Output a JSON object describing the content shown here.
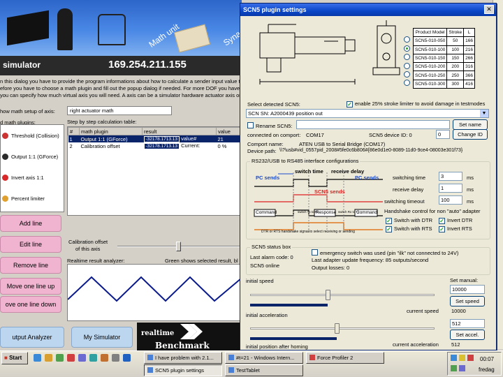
{
  "simulator": {
    "banner_title": "simulator",
    "banner_ip": "169.254.211.155",
    "banner_math": "Math unit",
    "banner_synap": "Synap",
    "info_lines": [
      "n this dialog you have to provide the program informations about how to calculate a sender input value t",
      "efore you have to choose a math plugin and fill out the popup dialog if needed. For more DOF you have",
      "you can specify how much virtual axis you will need. A axis can be a simulator hardware actuator axis or"
    ],
    "show_math_label": "how math setup of axis:",
    "axis_select": "right actuator math",
    "step_table_label": "Step by step calculation table:",
    "math_plugins_label": "d math plugins:",
    "plugins": [
      "Threshold (Collision)",
      "Output 1:1 (GForce)",
      "Invert axis 1:1",
      "Percent limiter"
    ],
    "table_headers": [
      "#",
      "math plugin",
      "result",
      "value"
    ],
    "table_rows": [
      {
        "num": "1",
        "plugin": "Output 1:1 (GForce)",
        "result": "-32178.1713.13",
        "vlabel": "value#",
        "value": "21"
      },
      {
        "num": "2",
        "plugin": "Calibration offset",
        "result": "-32178.1713.13",
        "vlabel": "Current:",
        "value": "0 %"
      }
    ],
    "buttons": [
      "Add line",
      "Edit line",
      "Remove line",
      "Move one line up",
      "ove one line down"
    ],
    "calib_label_1": "Calibration offset",
    "calib_label_2": "of this axis",
    "analyzer_label": "Realtime result analyzer:",
    "analyzer_hint": "Green shows selected result, bl",
    "output_analyzer": "utput Analyzer",
    "my_simulator": "My Simulator",
    "benchmark_1": "realtime",
    "benchmark_2": "Benchmark"
  },
  "dialog": {
    "title": "SCN5 plugin settings",
    "product_table": {
      "headers": [
        "Product Model",
        "Stroke",
        "L"
      ],
      "rows": [
        [
          "SCN5-010-050",
          "50",
          "166"
        ],
        [
          "SCN5-010-100",
          "100",
          "216"
        ],
        [
          "SCN5-010-150",
          "150",
          "266"
        ],
        [
          "SCN5-010-200",
          "200",
          "316"
        ],
        [
          "SCN5-010-250",
          "250",
          "366"
        ],
        [
          "SCN5-010-300",
          "300",
          "416"
        ]
      ],
      "selected_index": 1
    },
    "select_label": "Select detected SCN5:",
    "limiter_label": "enable 25% stroke limiter to avoid damage in testmodes",
    "scn5_select": "SCN SN: A2000439 position out",
    "rename_label": "Rename SCN5:",
    "set_name": "Set name",
    "connected_label": "connected on comport:",
    "comport": "COM17",
    "device_id_label": "SCN5 device ID: 0",
    "device_id_value": "0",
    "change_id": "Change ID",
    "comport_name_label": "Comport name:",
    "comport_name": "ATEN USB to Serial Bridge (COM17)",
    "device_path_label": "Device path:",
    "device_path": "\\\\?\\usb#vid_0557pid_2008#5fe0c6b806#{86e0d1e0-8089-11d0-9ce4-08003e301f73}",
    "rs_group_title": "RS232/USB to RS485 interface configurations",
    "switch_time_label": "switch time",
    "receive_delay_label": "receive delay",
    "pc_sends_1": "PC sends",
    "pc_sends_2": "PC sends",
    "scn5_sends": "SCN5 sends",
    "command_1": "Command",
    "response": "Response",
    "command_2": "Command",
    "switch_tx_rx": "switch Tx to Rx",
    "switch_rx_tx": "switch Rx to Tx",
    "dtr_note": "DTR or RTS handshake signal to select receiving or sending",
    "switching_time_label": "switching time",
    "switching_time": "3",
    "receive_delay_value": "1",
    "switching_timeout_label": "switching timeout",
    "switching_timeout": "100",
    "unit_ms": "ms",
    "handshake_label": "Handshake control for non \"auto\" adapter",
    "switch_dtr": "Switch with DTR",
    "invert_dtr": "Invert DTR",
    "switch_rts": "Switch with RTS",
    "invert_rts": "Invert RTS",
    "status_group": "SCN5 status box",
    "emergency": "emergency switch was used (pin \"ilk\" not connected to 24V)",
    "alarm": "Last alarm code: 0",
    "online": "SCN5 online",
    "update_freq": "Last adapter update frequency: 85 outputs/second",
    "output_losses": "Output losses: 0",
    "initial_speed": "initial speed",
    "set_manual": "Set manual:",
    "speed_value": "10000",
    "set_speed": "Set speed",
    "current_speed_label": "current speed",
    "current_speed": "10000",
    "speed_fraction": 0.42,
    "initial_accel": "initial acceleration",
    "accel_value": "512",
    "set_accel": "Set accel.",
    "current_accel_label": "current acceleration",
    "current_accel": "512",
    "accel_fraction": 0.47,
    "initial_position": "initial position after homing"
  },
  "taskbar": {
    "start": "Start",
    "tasks": [
      "I have problem with 2.1...",
      "#t=21 - Windows Intern...",
      "Force Profiler 2",
      "SCN5 plugin settings",
      "TestTablet"
    ],
    "clock": "00:07",
    "user": "fredag"
  },
  "colors": {
    "titlebar": "#0a46c8",
    "pink_button": "#f0b4d0",
    "blue_button": "#bcd6f0",
    "orange_signal": "#e07820",
    "red_signal": "#e02020",
    "blue_text": "#1a4acc"
  }
}
